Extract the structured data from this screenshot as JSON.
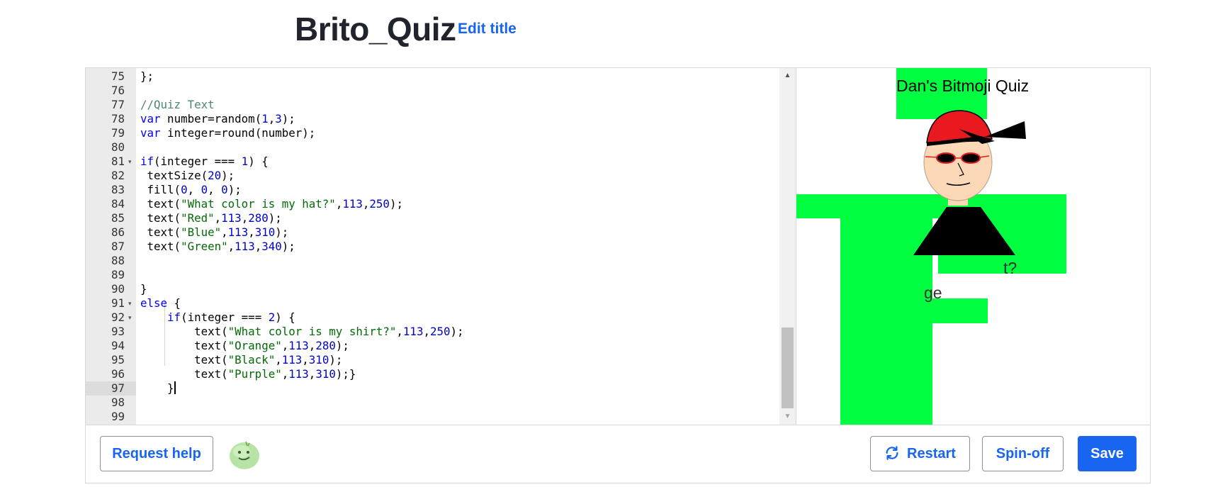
{
  "header": {
    "title": "Brito_Quiz",
    "edit_title_label": "Edit title"
  },
  "editor": {
    "active_line": 97,
    "lines": [
      {
        "n": "75",
        "fold": false
      },
      {
        "n": "76",
        "fold": false
      },
      {
        "n": "77",
        "fold": false
      },
      {
        "n": "78",
        "fold": false
      },
      {
        "n": "79",
        "fold": false
      },
      {
        "n": "80",
        "fold": false
      },
      {
        "n": "81",
        "fold": true
      },
      {
        "n": "82",
        "fold": false
      },
      {
        "n": "83",
        "fold": false
      },
      {
        "n": "84",
        "fold": false
      },
      {
        "n": "85",
        "fold": false
      },
      {
        "n": "86",
        "fold": false
      },
      {
        "n": "87",
        "fold": false
      },
      {
        "n": "88",
        "fold": false
      },
      {
        "n": "89",
        "fold": false
      },
      {
        "n": "90",
        "fold": false
      },
      {
        "n": "91",
        "fold": true
      },
      {
        "n": "92",
        "fold": true
      },
      {
        "n": "93",
        "fold": false
      },
      {
        "n": "94",
        "fold": false
      },
      {
        "n": "95",
        "fold": false
      },
      {
        "n": "96",
        "fold": false
      },
      {
        "n": "97",
        "fold": false
      },
      {
        "n": "98",
        "fold": false
      },
      {
        "n": "99",
        "fold": false
      }
    ],
    "code": [
      "};",
      "",
      "//Quiz Text",
      "var number=random(1,3);",
      "var integer=round(number);",
      "",
      "if(integer === 1) {",
      " textSize(20);",
      " fill(0, 0, 0);",
      " text(\"What color is my hat?\",113,250);",
      " text(\"Red\",113,280);",
      " text(\"Blue\",113,310);",
      " text(\"Green\",113,340);",
      "",
      "",
      "}",
      "else {",
      "    if(integer === 2) {",
      "        text(\"What color is my shirt?\",113,250);",
      "        text(\"Orange\",113,280);",
      "        text(\"Black\",113,310);",
      "        text(\"Purple\",113,310);}",
      "    }",
      "",
      ""
    ]
  },
  "canvas": {
    "heading": "Dan's Bitmoji Quiz",
    "partial_text_1": "t?",
    "partial_text_2": "ge",
    "colors": {
      "green": "#00ff40",
      "red_hat": "#e8191f",
      "skin": "#fcd9b6",
      "shirt": "#000000"
    }
  },
  "toolbar": {
    "request_help_label": "Request help",
    "restart_label": "Restart",
    "spinoff_label": "Spin-off",
    "save_label": "Save",
    "accent_color": "#1865f2"
  }
}
